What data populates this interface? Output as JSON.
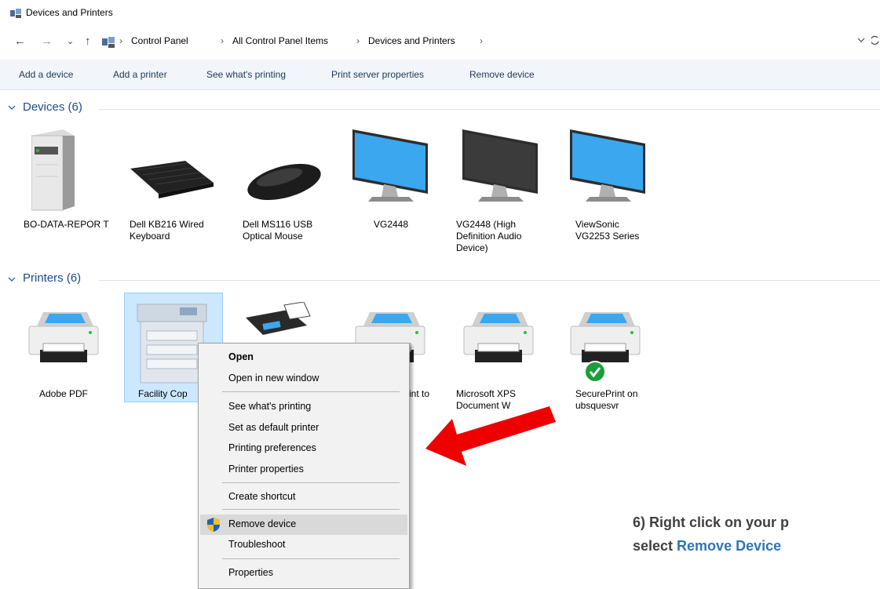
{
  "window": {
    "title": "Devices and Printers"
  },
  "address": {
    "crumbs": [
      "Control Panel",
      "All Control Panel Items",
      "Devices and Printers"
    ],
    "separator": "›",
    "dropdown_icon": "chevron-down-icon",
    "refresh_icon": "refresh-icon"
  },
  "nav": {
    "back": "←",
    "forward": "→",
    "recent": "⌄",
    "up": "↑"
  },
  "toolbar": {
    "add_device": "Add a device",
    "add_printer": "Add a printer",
    "see_printing": "See what's printing",
    "print_server": "Print server properties",
    "remove_device": "Remove device"
  },
  "devices": {
    "header": "Devices (6)",
    "items": [
      {
        "label": "BO-DATA-REPOR T",
        "icon": "computer-tower-icon"
      },
      {
        "label": "Dell KB216 Wired Keyboard",
        "icon": "keyboard-icon"
      },
      {
        "label": "Dell MS116 USB Optical Mouse",
        "icon": "mouse-icon"
      },
      {
        "label": "VG2448",
        "icon": "monitor-icon"
      },
      {
        "label": "VG2448 (High Definition Audio Device)",
        "icon": "monitor-dark-icon"
      },
      {
        "label": "ViewSonic VG2253 Series",
        "icon": "monitor-icon"
      }
    ]
  },
  "printers": {
    "header": "Printers (6)",
    "items": [
      {
        "label": "Adobe PDF",
        "icon": "printer-icon"
      },
      {
        "label": "Facility Cop",
        "icon": "copier-icon"
      },
      {
        "label": "int to",
        "icon": "fax-icon"
      },
      {
        "label": "",
        "icon": "printer-icon"
      },
      {
        "label": "Microsoft XPS Document W",
        "icon": "printer-icon"
      },
      {
        "label": "SecurePrint on ubsquesvr",
        "icon": "printer-default-icon"
      }
    ]
  },
  "context_menu": {
    "open": "Open",
    "open_new_window": "Open in new window",
    "see_printing": "See what's printing",
    "set_default": "Set as default printer",
    "printing_prefs": "Printing preferences",
    "printer_props": "Printer properties",
    "create_shortcut": "Create shortcut",
    "remove_device": "Remove device",
    "troubleshoot": "Troubleshoot",
    "properties": "Properties"
  },
  "annotation": {
    "line1": "6) Right click on your p",
    "line2_prefix": "select ",
    "line2_highlight": "Remove Device",
    "arrow_color": "#ee0000"
  },
  "colors": {
    "accent": "#2e75b6",
    "selection": "#cce8ff",
    "default_check": "#1a9e3c"
  }
}
